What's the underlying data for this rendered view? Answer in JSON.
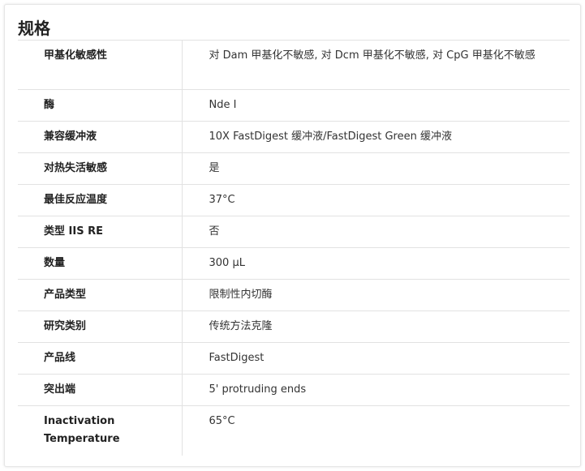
{
  "section": {
    "title": "规格"
  },
  "rows": [
    {
      "key": "甲基化敏感性",
      "value": "对 Dam 甲基化不敏感, 对 Dcm 甲基化不敏感, 对 CpG 甲基化不敏感"
    },
    {
      "key": "酶",
      "value": "Nde I"
    },
    {
      "key": "兼容缓冲液",
      "value": "10X FastDigest 缓冲液/FastDigest Green 缓冲液"
    },
    {
      "key": "对热失活敏感",
      "value": "是"
    },
    {
      "key": "最佳反应温度",
      "value": "37°C"
    },
    {
      "key": "类型 IIS RE",
      "value": "否"
    },
    {
      "key": "数量",
      "value": "300 µL"
    },
    {
      "key": "产品类型",
      "value": "限制性内切酶"
    },
    {
      "key": "研究类别",
      "value": "传统方法克隆"
    },
    {
      "key": "产品线",
      "value": "FastDigest"
    },
    {
      "key": "突出端",
      "value": "5' protruding ends"
    },
    {
      "key": "Inactivation Temperature",
      "value": "65°C"
    }
  ]
}
